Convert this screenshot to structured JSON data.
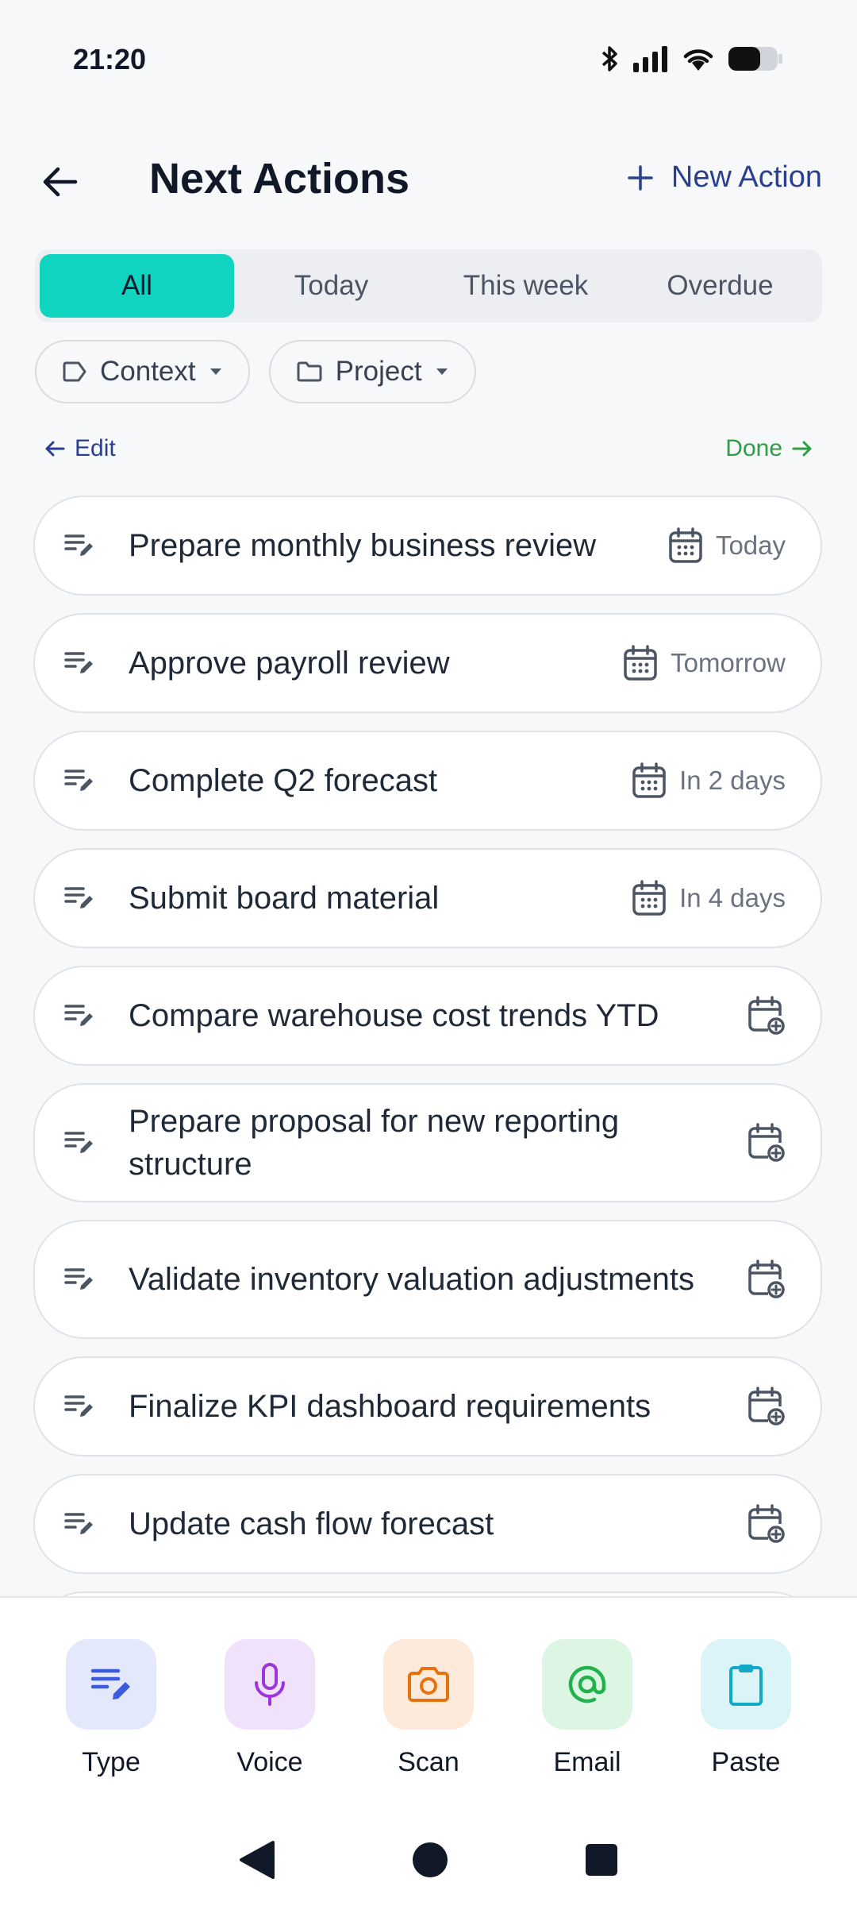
{
  "status": {
    "time": "21:20"
  },
  "header": {
    "title": "Next Actions",
    "new_action_label": "New Action"
  },
  "tabs": [
    {
      "label": "All",
      "active": true
    },
    {
      "label": "Today",
      "active": false
    },
    {
      "label": "This week",
      "active": false
    },
    {
      "label": "Overdue",
      "active": false
    }
  ],
  "filters": {
    "context_label": "Context",
    "project_label": "Project"
  },
  "edit_label": "Edit",
  "done_label": "Done",
  "actions": [
    {
      "title": "Prepare monthly business review",
      "due": "Today"
    },
    {
      "title": "Approve payroll review",
      "due": "Tomorrow"
    },
    {
      "title": "Complete Q2 forecast",
      "due": "In 2 days"
    },
    {
      "title": "Submit board material",
      "due": "In 4 days"
    },
    {
      "title": "Compare warehouse cost trends YTD",
      "due": ""
    },
    {
      "title": "Prepare proposal for new reporting structure",
      "due": ""
    },
    {
      "title": "Validate inventory valuation adjustments",
      "due": ""
    },
    {
      "title": "Finalize KPI dashboard requirements",
      "due": ""
    },
    {
      "title": "Update cash flow forecast",
      "due": ""
    }
  ],
  "capture": [
    {
      "label": "Type",
      "icon": "type-icon",
      "tile_color": "#e3e9fb",
      "icon_color": "#3b5bdb"
    },
    {
      "label": "Voice",
      "icon": "microphone-icon",
      "tile_color": "#f1e2fb",
      "icon_color": "#9c36d8"
    },
    {
      "label": "Scan",
      "icon": "camera-icon",
      "tile_color": "#fdeadb",
      "icon_color": "#e8730c"
    },
    {
      "label": "Email",
      "icon": "at-sign-icon",
      "tile_color": "#ddf6e4",
      "icon_color": "#22b24c"
    },
    {
      "label": "Paste",
      "icon": "clipboard-icon",
      "tile_color": "#dbf4f8",
      "icon_color": "#12a9c8"
    }
  ],
  "colors": {
    "accent": "#10d3c0",
    "link": "#2b3f8f",
    "done": "#2f9e44"
  }
}
